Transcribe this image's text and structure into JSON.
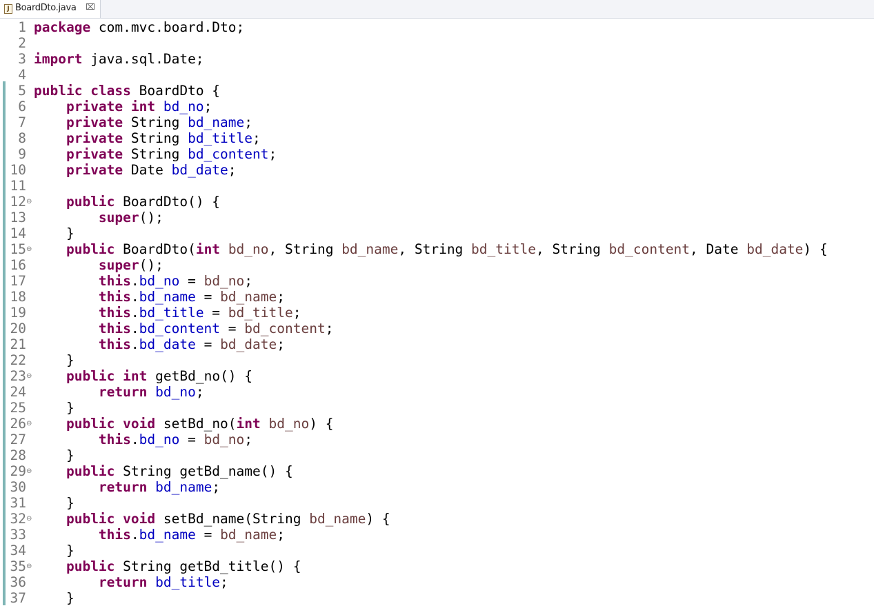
{
  "editor_tab": {
    "title": "BoardDto.java",
    "close_glyph": "⌧",
    "file_icon": "java-file-icon"
  },
  "colors": {
    "keyword": "#7f0055",
    "field": "#0000c0",
    "parameter": "#6a3e3e",
    "line_number": "#787878",
    "ruler": "#7fb5b5"
  },
  "code_lines": [
    {
      "n": "1",
      "fold": false,
      "segs": [
        [
          "kw",
          "package"
        ],
        [
          "",
          "com.mvc.board.Dto;"
        ]
      ]
    },
    {
      "n": "2",
      "fold": false,
      "segs": []
    },
    {
      "n": "3",
      "fold": false,
      "segs": [
        [
          "kw",
          "import"
        ],
        [
          "",
          "java.sql.Date;"
        ]
      ]
    },
    {
      "n": "4",
      "fold": false,
      "segs": []
    },
    {
      "n": "5",
      "fold": false,
      "segs": [
        [
          "kw",
          "public"
        ],
        [
          "",
          " "
        ],
        [
          "kw",
          "class"
        ],
        [
          "",
          " BoardDto {"
        ]
      ]
    },
    {
      "n": "6",
      "fold": false,
      "segs": [
        [
          "",
          "    "
        ],
        [
          "kw",
          "private"
        ],
        [
          "",
          " "
        ],
        [
          "kw",
          "int"
        ],
        [
          "",
          " "
        ],
        [
          "fld",
          "bd_no"
        ],
        [
          "",
          ";"
        ]
      ]
    },
    {
      "n": "7",
      "fold": false,
      "segs": [
        [
          "",
          "    "
        ],
        [
          "kw",
          "private"
        ],
        [
          "",
          " String "
        ],
        [
          "fld",
          "bd_name"
        ],
        [
          "",
          ";"
        ]
      ]
    },
    {
      "n": "8",
      "fold": false,
      "segs": [
        [
          "",
          "    "
        ],
        [
          "kw",
          "private"
        ],
        [
          "",
          " String "
        ],
        [
          "fld",
          "bd_title"
        ],
        [
          "",
          ";"
        ]
      ]
    },
    {
      "n": "9",
      "fold": false,
      "segs": [
        [
          "",
          "    "
        ],
        [
          "kw",
          "private"
        ],
        [
          "",
          " String "
        ],
        [
          "fld",
          "bd_content"
        ],
        [
          "",
          ";"
        ]
      ]
    },
    {
      "n": "10",
      "fold": false,
      "segs": [
        [
          "",
          "    "
        ],
        [
          "kw",
          "private"
        ],
        [
          "",
          " Date "
        ],
        [
          "fld",
          "bd_date"
        ],
        [
          "",
          ";"
        ]
      ]
    },
    {
      "n": "11",
      "fold": false,
      "segs": []
    },
    {
      "n": "12",
      "fold": true,
      "segs": [
        [
          "",
          "    "
        ],
        [
          "kw",
          "public"
        ],
        [
          "",
          " BoardDto() {"
        ]
      ]
    },
    {
      "n": "13",
      "fold": false,
      "segs": [
        [
          "",
          "        "
        ],
        [
          "kw",
          "super"
        ],
        [
          "",
          "();"
        ]
      ]
    },
    {
      "n": "14",
      "fold": false,
      "segs": [
        [
          "",
          "    }"
        ]
      ]
    },
    {
      "n": "15",
      "fold": true,
      "segs": [
        [
          "",
          "    "
        ],
        [
          "kw",
          "public"
        ],
        [
          "",
          " BoardDto("
        ],
        [
          "kw",
          "int"
        ],
        [
          "",
          " "
        ],
        [
          "prm",
          "bd_no"
        ],
        [
          "",
          ", String "
        ],
        [
          "prm",
          "bd_name"
        ],
        [
          "",
          ", String "
        ],
        [
          "prm",
          "bd_title"
        ],
        [
          "",
          ", String "
        ],
        [
          "prm",
          "bd_content"
        ],
        [
          "",
          ", Date "
        ],
        [
          "prm",
          "bd_date"
        ],
        [
          "",
          ") {"
        ]
      ]
    },
    {
      "n": "16",
      "fold": false,
      "segs": [
        [
          "",
          "        "
        ],
        [
          "kw",
          "super"
        ],
        [
          "",
          "();"
        ]
      ]
    },
    {
      "n": "17",
      "fold": false,
      "segs": [
        [
          "",
          "        "
        ],
        [
          "kw",
          "this"
        ],
        [
          "",
          "."
        ],
        [
          "fld",
          "bd_no"
        ],
        [
          "",
          " = "
        ],
        [
          "prm",
          "bd_no"
        ],
        [
          "",
          ";"
        ]
      ]
    },
    {
      "n": "18",
      "fold": false,
      "segs": [
        [
          "",
          "        "
        ],
        [
          "kw",
          "this"
        ],
        [
          "",
          "."
        ],
        [
          "fld",
          "bd_name"
        ],
        [
          "",
          " = "
        ],
        [
          "prm",
          "bd_name"
        ],
        [
          "",
          ";"
        ]
      ]
    },
    {
      "n": "19",
      "fold": false,
      "segs": [
        [
          "",
          "        "
        ],
        [
          "kw",
          "this"
        ],
        [
          "",
          "."
        ],
        [
          "fld",
          "bd_title"
        ],
        [
          "",
          " = "
        ],
        [
          "prm",
          "bd_title"
        ],
        [
          "",
          ";"
        ]
      ]
    },
    {
      "n": "20",
      "fold": false,
      "segs": [
        [
          "",
          "        "
        ],
        [
          "kw",
          "this"
        ],
        [
          "",
          "."
        ],
        [
          "fld",
          "bd_content"
        ],
        [
          "",
          " = "
        ],
        [
          "prm",
          "bd_content"
        ],
        [
          "",
          ";"
        ]
      ]
    },
    {
      "n": "21",
      "fold": false,
      "segs": [
        [
          "",
          "        "
        ],
        [
          "kw",
          "this"
        ],
        [
          "",
          "."
        ],
        [
          "fld",
          "bd_date"
        ],
        [
          "",
          " = "
        ],
        [
          "prm",
          "bd_date"
        ],
        [
          "",
          ";"
        ]
      ]
    },
    {
      "n": "22",
      "fold": false,
      "segs": [
        [
          "",
          "    }"
        ]
      ]
    },
    {
      "n": "23",
      "fold": true,
      "segs": [
        [
          "",
          "    "
        ],
        [
          "kw",
          "public"
        ],
        [
          "",
          " "
        ],
        [
          "kw",
          "int"
        ],
        [
          "",
          " getBd_no() {"
        ]
      ]
    },
    {
      "n": "24",
      "fold": false,
      "segs": [
        [
          "",
          "        "
        ],
        [
          "kw",
          "return"
        ],
        [
          "",
          " "
        ],
        [
          "fld",
          "bd_no"
        ],
        [
          "",
          ";"
        ]
      ]
    },
    {
      "n": "25",
      "fold": false,
      "segs": [
        [
          "",
          "    }"
        ]
      ]
    },
    {
      "n": "26",
      "fold": true,
      "segs": [
        [
          "",
          "    "
        ],
        [
          "kw",
          "public"
        ],
        [
          "",
          " "
        ],
        [
          "kw",
          "void"
        ],
        [
          "",
          " setBd_no("
        ],
        [
          "kw",
          "int"
        ],
        [
          "",
          " "
        ],
        [
          "prm",
          "bd_no"
        ],
        [
          "",
          ") {"
        ]
      ]
    },
    {
      "n": "27",
      "fold": false,
      "segs": [
        [
          "",
          "        "
        ],
        [
          "kw",
          "this"
        ],
        [
          "",
          "."
        ],
        [
          "fld",
          "bd_no"
        ],
        [
          "",
          " = "
        ],
        [
          "prm",
          "bd_no"
        ],
        [
          "",
          ";"
        ]
      ]
    },
    {
      "n": "28",
      "fold": false,
      "segs": [
        [
          "",
          "    }"
        ]
      ]
    },
    {
      "n": "29",
      "fold": true,
      "segs": [
        [
          "",
          "    "
        ],
        [
          "kw",
          "public"
        ],
        [
          "",
          " String getBd_name() {"
        ]
      ]
    },
    {
      "n": "30",
      "fold": false,
      "segs": [
        [
          "",
          "        "
        ],
        [
          "kw",
          "return"
        ],
        [
          "",
          " "
        ],
        [
          "fld",
          "bd_name"
        ],
        [
          "",
          ";"
        ]
      ]
    },
    {
      "n": "31",
      "fold": false,
      "segs": [
        [
          "",
          "    }"
        ]
      ]
    },
    {
      "n": "32",
      "fold": true,
      "segs": [
        [
          "",
          "    "
        ],
        [
          "kw",
          "public"
        ],
        [
          "",
          " "
        ],
        [
          "kw",
          "void"
        ],
        [
          "",
          " setBd_name(String "
        ],
        [
          "prm",
          "bd_name"
        ],
        [
          "",
          ") {"
        ]
      ]
    },
    {
      "n": "33",
      "fold": false,
      "segs": [
        [
          "",
          "        "
        ],
        [
          "kw",
          "this"
        ],
        [
          "",
          "."
        ],
        [
          "fld",
          "bd_name"
        ],
        [
          "",
          " = "
        ],
        [
          "prm",
          "bd_name"
        ],
        [
          "",
          ";"
        ]
      ]
    },
    {
      "n": "34",
      "fold": false,
      "segs": [
        [
          "",
          "    }"
        ]
      ]
    },
    {
      "n": "35",
      "fold": true,
      "segs": [
        [
          "",
          "    "
        ],
        [
          "kw",
          "public"
        ],
        [
          "",
          " String getBd_title() {"
        ]
      ]
    },
    {
      "n": "36",
      "fold": false,
      "segs": [
        [
          "",
          "        "
        ],
        [
          "kw",
          "return"
        ],
        [
          "",
          " "
        ],
        [
          "fld",
          "bd_title"
        ],
        [
          "",
          ";"
        ]
      ]
    },
    {
      "n": "37",
      "fold": false,
      "segs": [
        [
          "",
          "    }"
        ]
      ]
    }
  ]
}
